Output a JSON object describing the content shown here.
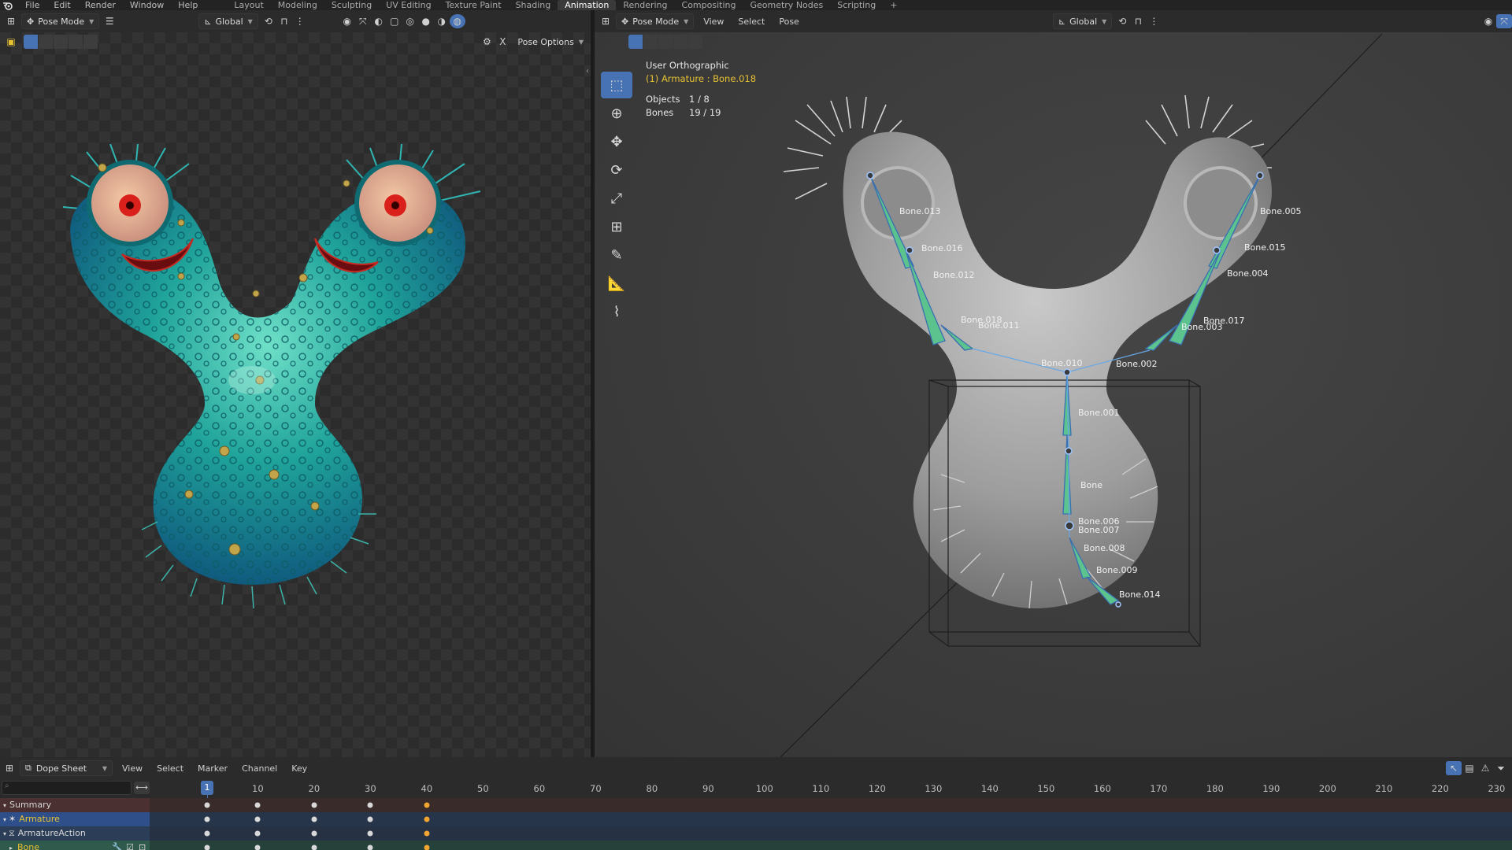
{
  "app": {
    "menus": [
      "File",
      "Edit",
      "Render",
      "Window",
      "Help"
    ],
    "workspaces": [
      "Layout",
      "Modeling",
      "Sculpting",
      "UV Editing",
      "Texture Paint",
      "Shading",
      "Animation",
      "Rendering",
      "Compositing",
      "Geometry Nodes",
      "Scripting",
      "+"
    ],
    "active_workspace": "Animation"
  },
  "left_viewport": {
    "mode": "Pose Mode",
    "orientation": "Global",
    "pose_options": "Pose Options",
    "close_glyph": "X"
  },
  "right_viewport": {
    "mode": "Pose Mode",
    "menus": [
      "View",
      "Select",
      "Pose"
    ],
    "orientation": "Global",
    "overlay": {
      "view_name": "User Orthographic",
      "active": "(1) Armature : Bone.018",
      "objects_label": "Objects",
      "objects_value": "1 / 8",
      "bones_label": "Bones",
      "bones_value": "19 / 19"
    },
    "bone_labels": [
      "Bone.013",
      "Bone.016",
      "Bone.012",
      "Bone.018",
      "Bone.011",
      "Bone.010",
      "Bone.001",
      "Bone",
      "Bone.006",
      "Bone.007",
      "Bone.008",
      "Bone.009",
      "Bone.014",
      "Bone.005",
      "Bone.015",
      "Bone.004",
      "Bone.017",
      "Bone.003",
      "Bone.002"
    ]
  },
  "dope_sheet": {
    "mode": "Dope Sheet",
    "menus": [
      "View",
      "Select",
      "Marker",
      "Channel",
      "Key"
    ],
    "current_frame": "1",
    "ruler": [
      "10",
      "20",
      "30",
      "40",
      "50",
      "60",
      "70",
      "80",
      "90",
      "100",
      "110",
      "120",
      "130",
      "140",
      "150",
      "160",
      "170",
      "180",
      "190",
      "200",
      "210",
      "220",
      "230"
    ],
    "channels": [
      "Summary",
      "Armature",
      "ArmatureAction",
      "Bone"
    ],
    "keyframes": [
      1,
      10,
      20,
      30,
      40
    ]
  },
  "colors": {
    "accent": "#4772b3",
    "active_text": "#e6c232",
    "selected_key": "#f0a531",
    "creature_teal": "#1fa39a"
  }
}
